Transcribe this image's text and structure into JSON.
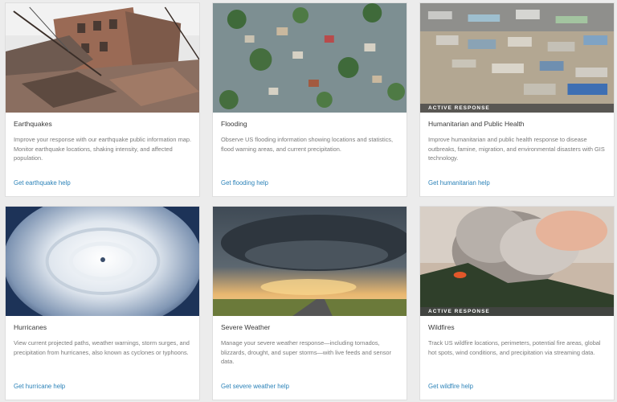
{
  "cards": [
    {
      "title": "Earthquakes",
      "description": "Improve your response with our earthquake public information map. Monitor earthquake locations, shaking intensity, and affected population.",
      "link": "Get earthquake help",
      "badge": "",
      "image": "collapsed-building-rubble-photo"
    },
    {
      "title": "Flooding",
      "description": "Observe US flooding information showing locations and statistics, flood warning areas, and current precipitation.",
      "link": "Get flooding help",
      "badge": "",
      "image": "flooded-neighborhood-aerial-photo"
    },
    {
      "title": "Humanitarian and Public Health",
      "description": "Improve humanitarian and public health response to disease outbreaks, famine, migration, and environmental disasters with GIS technology.",
      "link": "Get humanitarian help",
      "badge": "ACTIVE RESPONSE",
      "image": "refugee-settlement-aerial-photo"
    },
    {
      "title": "Hurricanes",
      "description": "View current projected paths, weather warnings, storm surges, and precipitation from hurricanes, also known as cyclones or typhoons.",
      "link": "Get hurricane help",
      "badge": "",
      "image": "hurricane-satellite-photo"
    },
    {
      "title": "Severe Weather",
      "description": "Manage your severe weather response—including tornados, blizzards, drought, and super storms—with live feeds and sensor data.",
      "link": "Get severe weather help",
      "badge": "",
      "image": "supercell-storm-photo"
    },
    {
      "title": "Wildfires",
      "description": "Track US wildfire locations, perimeters, potential fire areas, global hot spots, wind conditions, and precipitation via streaming data.",
      "link": "Get wildfire help",
      "badge": "ACTIVE RESPONSE",
      "image": "wildfire-smoke-plume-photo"
    }
  ],
  "colors": {
    "link": "#2b82b8",
    "title": "#3a3a3a",
    "description": "#7a7a7a",
    "badge_bg": "#464646"
  }
}
